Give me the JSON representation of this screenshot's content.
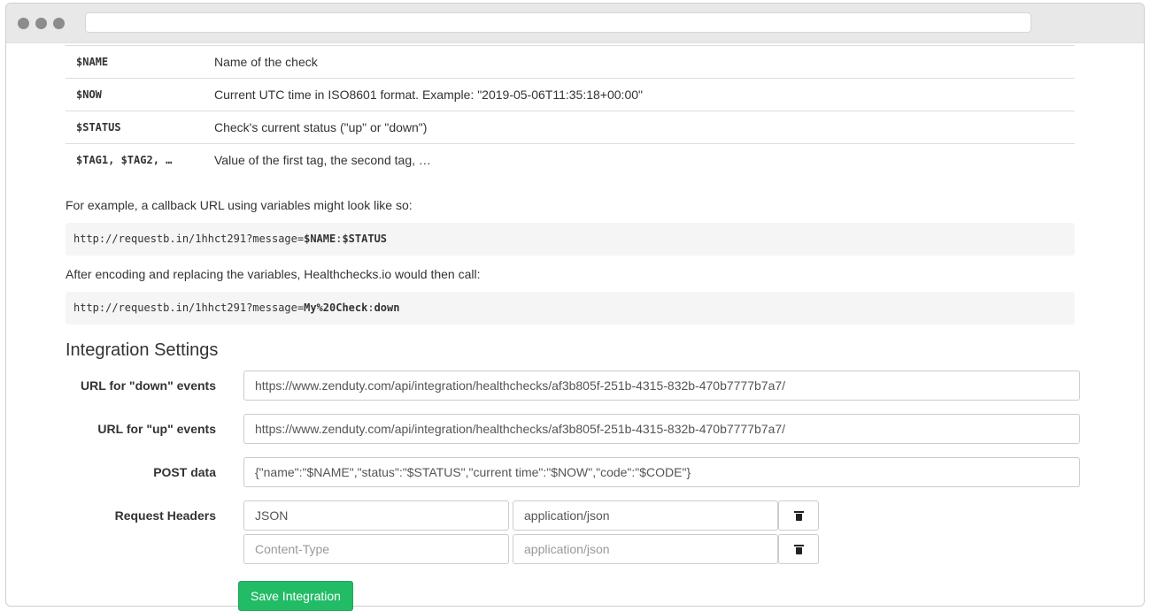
{
  "variables": [
    {
      "name": "$NAME",
      "desc": "Name of the check"
    },
    {
      "name": "$NOW",
      "desc": "Current UTC time in ISO8601 format. Example: \"2019-05-06T11:35:18+00:00\""
    },
    {
      "name": "$STATUS",
      "desc": "Check's current status (\"up\" or \"down\")"
    },
    {
      "name": "$TAG1, $TAG2, …",
      "desc": "Value of the first tag, the second tag, …"
    }
  ],
  "example_intro": "For example, a callback URL using variables might look like so:",
  "example_url": {
    "prefix": "http://requestb.in/1hhct291?message=",
    "bold1": "$NAME",
    "sep": ":",
    "bold2": "$STATUS"
  },
  "result_intro": "After encoding and replacing the variables, Healthchecks.io would then call:",
  "result_url": {
    "prefix": "http://requestb.in/1hhct291?message=",
    "bold1": "My%20Check",
    "sep": ":",
    "bold2": "down"
  },
  "settings": {
    "title": "Integration Settings",
    "down_label": "URL for \"down\" events",
    "down_value": "https://www.zenduty.com/api/integration/healthchecks/af3b805f-251b-4315-832b-470b7777b7a7/",
    "up_label": "URL for \"up\" events",
    "up_value": "https://www.zenduty.com/api/integration/healthchecks/af3b805f-251b-4315-832b-470b7777b7a7/",
    "post_label": "POST data",
    "post_value": "{\"name\":\"$NAME\",\"status\":\"$STATUS\",\"current time\":\"$NOW\",\"code\":\"$CODE\"}",
    "headers_label": "Request Headers",
    "headers": [
      {
        "name": "JSON",
        "value": "application/json"
      },
      {
        "name_placeholder": "Content-Type",
        "value_placeholder": "application/json"
      }
    ],
    "save_label": "Save Integration"
  },
  "icons": {
    "delete": "trash-icon"
  },
  "colors": {
    "save_button": "#22bc66",
    "code_bg": "#f5f5f5"
  }
}
